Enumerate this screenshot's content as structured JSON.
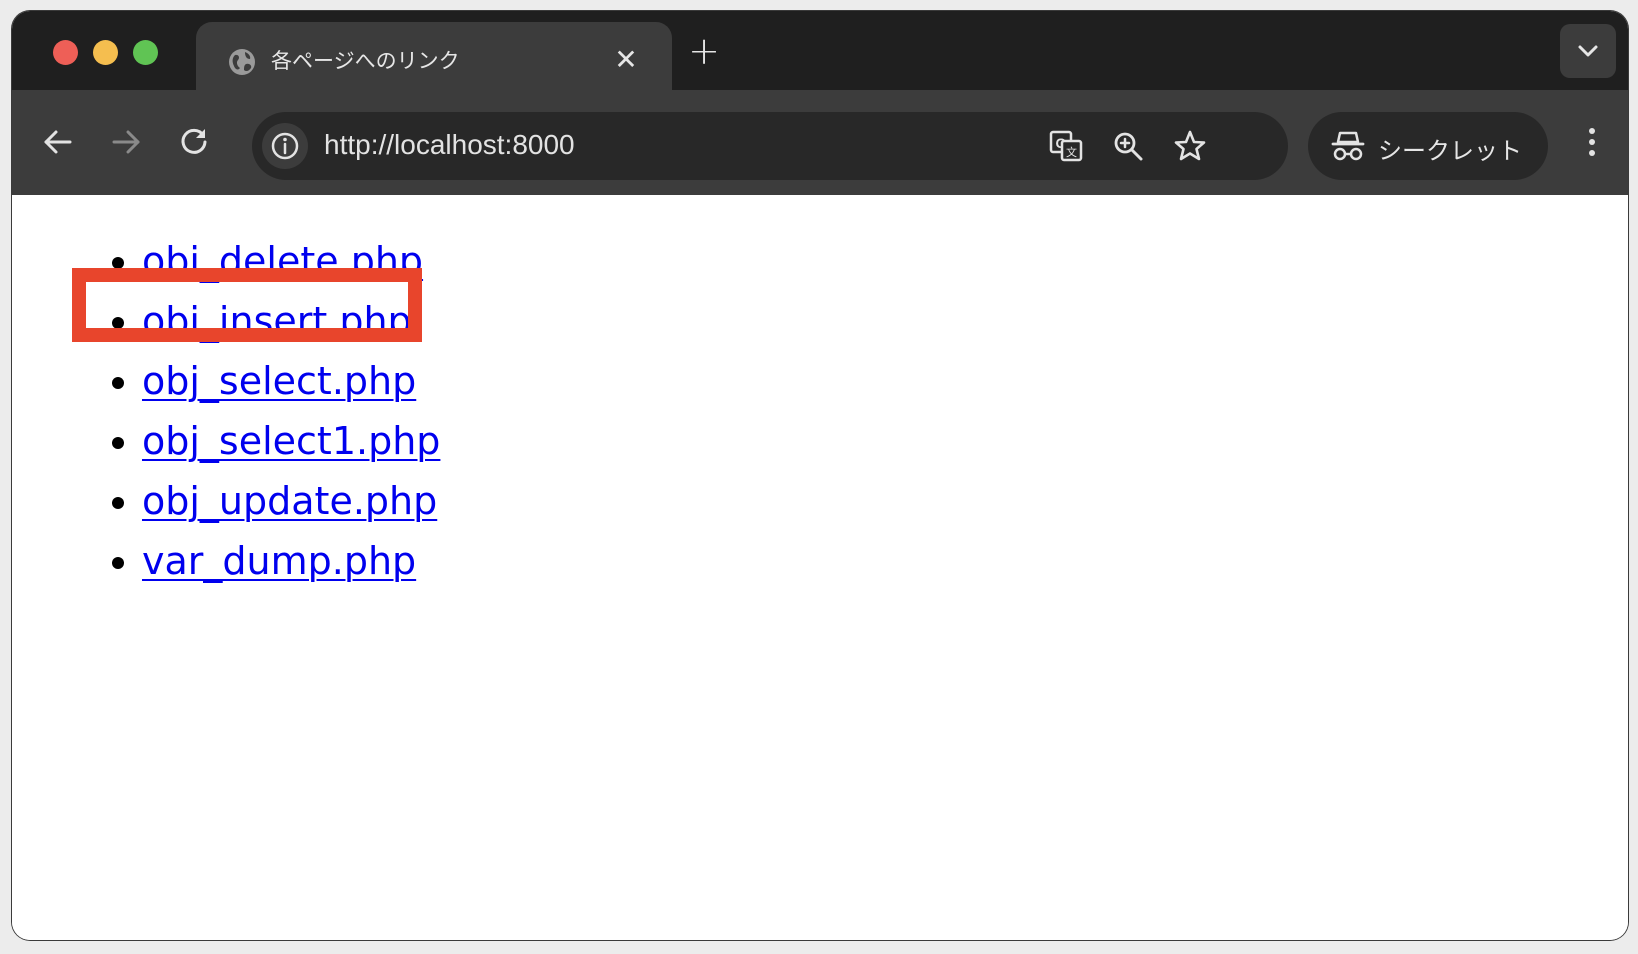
{
  "tab": {
    "title": "各ページへのリンク",
    "close_glyph": "✕",
    "new_tab_glyph": "+"
  },
  "tab_search": {
    "icon": "chevron-down-icon"
  },
  "toolbar": {
    "back_icon": "arrow-left-icon",
    "forward_icon": "arrow-right-icon",
    "reload_icon": "reload-icon",
    "url": "http://localhost:8000",
    "site_info_icon": "info-icon",
    "translate_icon": "translate-icon",
    "zoom_icon": "zoom-in-icon",
    "bookmark_icon": "star-icon",
    "incognito_label": "シークレット",
    "incognito_icon": "incognito-icon",
    "menu_icon": "kebab-menu-icon"
  },
  "page": {
    "links": [
      {
        "label": "obj_delete.php"
      },
      {
        "label": "obj_insert.php"
      },
      {
        "label": "obj_select.php"
      },
      {
        "label": "obj_select1.php"
      },
      {
        "label": "obj_update.php"
      },
      {
        "label": "var_dump.php"
      }
    ],
    "highlight_color": "#e8452c",
    "highlighted_link": "obj_insert.php"
  },
  "colors": {
    "tabbar_bg": "#1f1f1f",
    "toolbar_bg": "#3c3c3c",
    "omnibox_bg": "#282828",
    "link": "#0000ee",
    "traffic_red": "#ee5f57",
    "traffic_yellow": "#f5be4f",
    "traffic_green": "#60c454"
  }
}
